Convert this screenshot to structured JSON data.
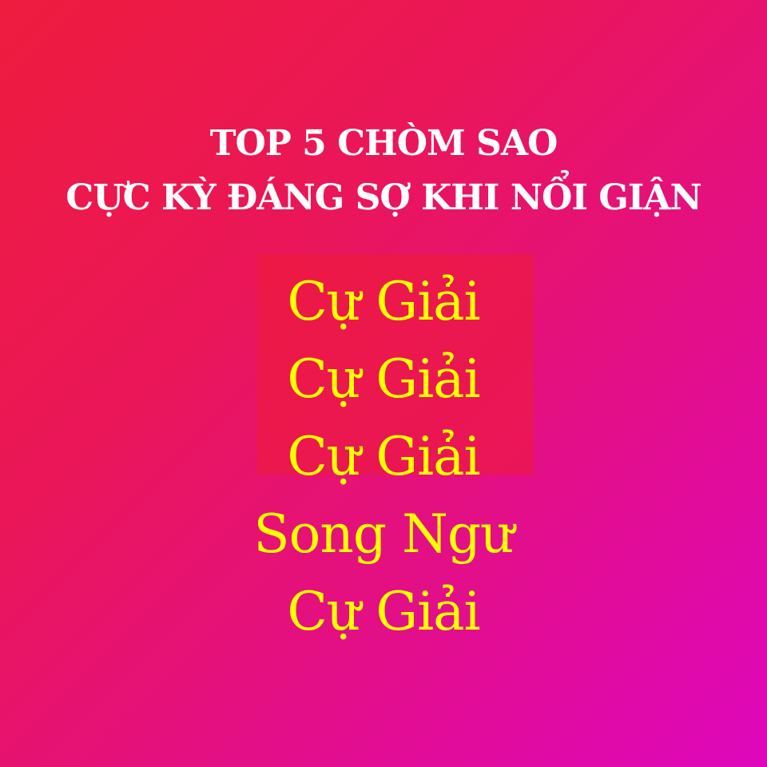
{
  "title": {
    "line1": "TOP 5 CHÒM SAO",
    "line2": "CỰC KỲ ĐÁNG SỢ KHI NỔI GIẬN"
  },
  "ranking": [
    "Cự Giải",
    "Cự Giải",
    "Cự Giải",
    "Song Ngư",
    "Cự Giải"
  ],
  "colors": {
    "background_start": "#ee1c3e",
    "background_end": "#de07bd",
    "title_text": "#ffffff",
    "ranking_text": "#ffff00"
  }
}
